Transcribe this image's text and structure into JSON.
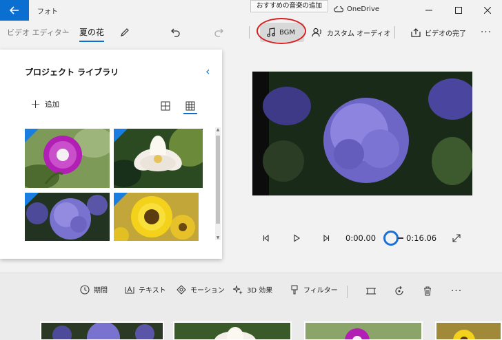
{
  "window": {
    "app_title": "フォト",
    "onedrive_label": "OneDrive",
    "tooltip": "おすすめの音楽の追加"
  },
  "toolbar": {
    "breadcrumb_root": "ビデオ エディター",
    "breadcrumb_current": "夏の花",
    "bgm_label": "BGM",
    "custom_audio_label": "カスタム オーディオ",
    "finish_video_label": "ビデオの完了"
  },
  "library": {
    "title": "プロジェクト ライブラリ",
    "add_label": "追加",
    "items": [
      {
        "name": "morning-glory"
      },
      {
        "name": "white-lotus"
      },
      {
        "name": "hydrangea"
      },
      {
        "name": "sunflower"
      }
    ]
  },
  "player": {
    "current_time": "0:00.00",
    "total_time": "0:16.06",
    "progress": 0
  },
  "edit_tools": {
    "duration_label": "期間",
    "text_label": "テキスト",
    "motion_label": "モーション",
    "effects_3d_label": "3D 効果",
    "filter_label": "フィルター"
  },
  "colors": {
    "accent": "#0a6fd0",
    "highlight_ring": "#d81f1f"
  }
}
